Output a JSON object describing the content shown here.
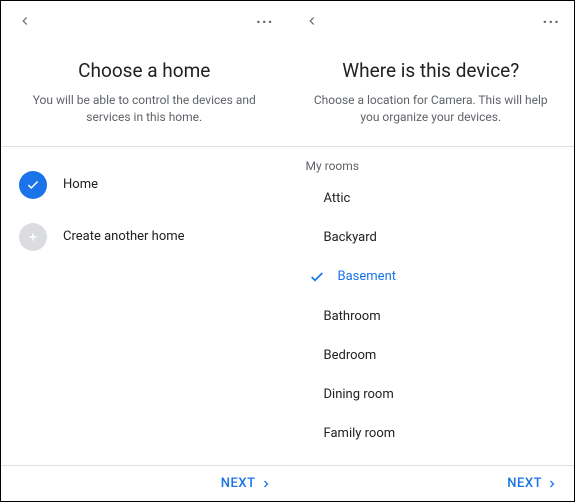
{
  "left": {
    "title": "Choose a home",
    "subtitle": "You will be able to control the devices and services in this home.",
    "options": [
      {
        "label": "Home",
        "selected": true
      },
      {
        "label": "Create another home",
        "selected": false
      }
    ],
    "next_label": "NEXT"
  },
  "right": {
    "title": "Where is this device?",
    "subtitle": "Choose a location for Camera. This will help you organize your devices.",
    "section_label": "My rooms",
    "rooms": [
      {
        "label": "Attic",
        "selected": false
      },
      {
        "label": "Backyard",
        "selected": false
      },
      {
        "label": "Basement",
        "selected": true
      },
      {
        "label": "Bathroom",
        "selected": false
      },
      {
        "label": "Bedroom",
        "selected": false
      },
      {
        "label": "Dining room",
        "selected": false
      },
      {
        "label": "Family room",
        "selected": false
      }
    ],
    "next_label": "NEXT"
  }
}
